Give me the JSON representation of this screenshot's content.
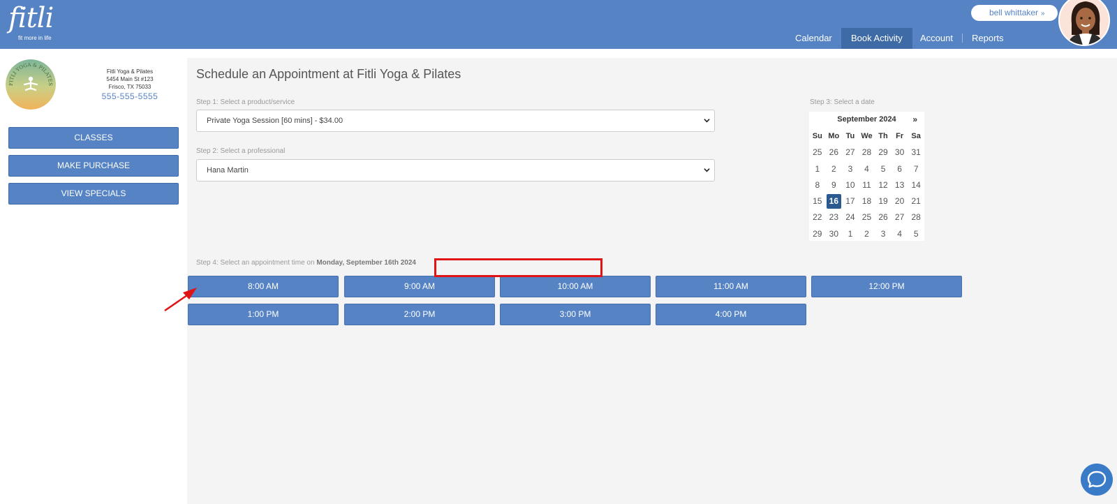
{
  "header": {
    "logo_text": "fitli",
    "logo_tagline": "fit more in life",
    "user_name": "bell whittaker",
    "user_chevron": "»",
    "nav": [
      "Calendar",
      "Book Activity",
      "Account",
      "Reports"
    ],
    "active_nav": "Book Activity",
    "colors": {
      "header_bg": "#5683c4",
      "active_tab": "#3e6aa6"
    }
  },
  "business": {
    "logo_text": "FITLI YOGA & PILATES",
    "name": "Fitli Yoga & Pilates",
    "address1": "5454 Main St #123",
    "address2": "Frisco, TX 75033",
    "phone": "555-555-5555"
  },
  "sidebar": {
    "buttons": [
      "CLASSES",
      "MAKE PURCHASE",
      "VIEW SPECIALS"
    ]
  },
  "main": {
    "title": "Schedule an Appointment at Fitli Yoga & Pilates",
    "step1_label": "Step 1: Select a product/service",
    "step1_value": "Private Yoga Session [60 mins] - $34.00",
    "step2_label": "Step 2: Select a professional",
    "step2_value": "Hana Martin",
    "step3_label": "Step 3: Select a date",
    "step4_label_prefix": "Step 4: Select an appointment time on ",
    "step4_date": "Monday, September 16th 2024"
  },
  "calendar": {
    "month_label": "September 2024",
    "next_label": "»",
    "weekdays": [
      "Su",
      "Mo",
      "Tu",
      "We",
      "Th",
      "Fr",
      "Sa"
    ],
    "weeks": [
      [
        "25",
        "26",
        "27",
        "28",
        "29",
        "30",
        "31"
      ],
      [
        "1",
        "2",
        "3",
        "4",
        "5",
        "6",
        "7"
      ],
      [
        "8",
        "9",
        "10",
        "11",
        "12",
        "13",
        "14"
      ],
      [
        "15",
        "16",
        "17",
        "18",
        "19",
        "20",
        "21"
      ],
      [
        "22",
        "23",
        "24",
        "25",
        "26",
        "27",
        "28"
      ],
      [
        "29",
        "30",
        "1",
        "2",
        "3",
        "4",
        "5"
      ]
    ],
    "selected_day": "16"
  },
  "times": [
    "8:00 AM",
    "9:00 AM",
    "10:00 AM",
    "11:00 AM",
    "12:00 PM",
    "1:00 PM",
    "2:00 PM",
    "3:00 PM",
    "4:00 PM"
  ],
  "chat": {
    "icon": "chat-bubble-icon"
  }
}
